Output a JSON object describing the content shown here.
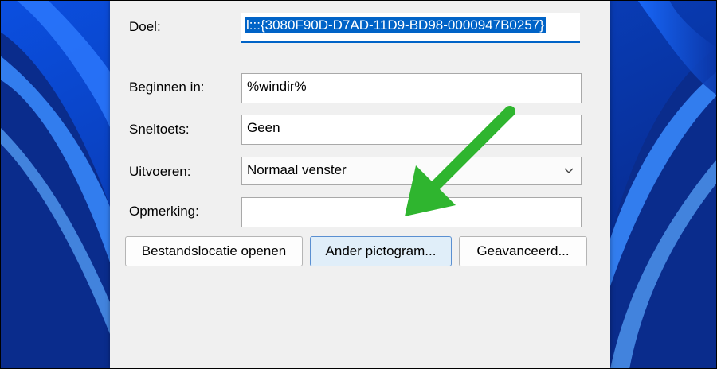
{
  "dialog": {
    "target": {
      "label": "Doel:",
      "value": "l:::{3080F90D-D7AD-11D9-BD98-0000947B0257}"
    },
    "start_in": {
      "label": "Beginnen in:",
      "value": "%windir%"
    },
    "shortcut_key": {
      "label": "Sneltoets:",
      "value": "Geen"
    },
    "run": {
      "label": "Uitvoeren:",
      "selected": "Normaal venster"
    },
    "comment": {
      "label": "Opmerking:",
      "value": ""
    },
    "buttons": {
      "open_location": "Bestandslocatie openen",
      "change_icon": "Ander pictogram...",
      "advanced": "Geavanceerd..."
    }
  },
  "colors": {
    "annotation_arrow": "#2fb52f",
    "selection": "#0063c7",
    "dialog_bg": "#f0f0f0"
  },
  "icons": [
    "chevron-down-icon",
    "annotation-arrow-icon"
  ]
}
